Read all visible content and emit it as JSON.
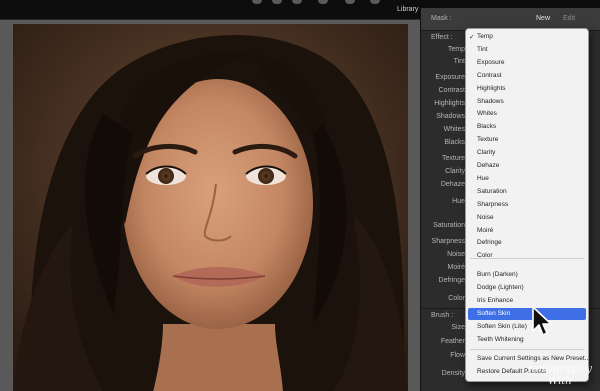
{
  "top_bar": {
    "module": "Library"
  },
  "panel": {
    "mask_label": "Mask :",
    "new_label": "New",
    "edit_label": "Edit",
    "effect_label": "Effect :",
    "sliders": [
      "Temp",
      "Tint",
      "Exposure",
      "Contrast",
      "Highlights",
      "Shadows",
      "Whites",
      "Blacks",
      "Texture",
      "Clarity",
      "Dehaze",
      "Hue",
      "Saturation",
      "Sharpness",
      "Noise",
      "Moiré",
      "Defringe",
      "Color"
    ],
    "brush_label": "Brush :",
    "brush_sliders": [
      "Size",
      "Feather",
      "Flow",
      "Density"
    ]
  },
  "menu": {
    "items": [
      {
        "label": "Temp",
        "checked": true
      },
      {
        "label": "Tint"
      },
      {
        "label": "Exposure"
      },
      {
        "label": "Contrast"
      },
      {
        "label": "Highlights"
      },
      {
        "label": "Shadows"
      },
      {
        "label": "Whites"
      },
      {
        "label": "Blacks"
      },
      {
        "label": "Texture"
      },
      {
        "label": "Clarity"
      },
      {
        "label": "Dehaze"
      },
      {
        "label": "Hue"
      },
      {
        "label": "Saturation"
      },
      {
        "label": "Sharpness"
      },
      {
        "label": "Noise"
      },
      {
        "label": "Moiré"
      },
      {
        "label": "Defringe"
      },
      {
        "label": "Color"
      }
    ],
    "presets": [
      {
        "label": "Burn (Darken)"
      },
      {
        "label": "Dodge (Lighten)"
      },
      {
        "label": "Iris Enhance"
      },
      {
        "label": "Soften Skin",
        "selected": true
      },
      {
        "label": "Soften Skin (Lite)"
      },
      {
        "label": "Teeth Whitening"
      }
    ],
    "actions": [
      {
        "label": "Save Current Settings as New Preset..."
      },
      {
        "label": "Restore Default Presets"
      }
    ]
  },
  "watermark": {
    "line1": "hotography",
    "line2": "With"
  },
  "colors": {
    "highlight": "#3f6fe6",
    "menu_bg": "#f2f2f2",
    "panel_bg": "#2c2c2c"
  }
}
